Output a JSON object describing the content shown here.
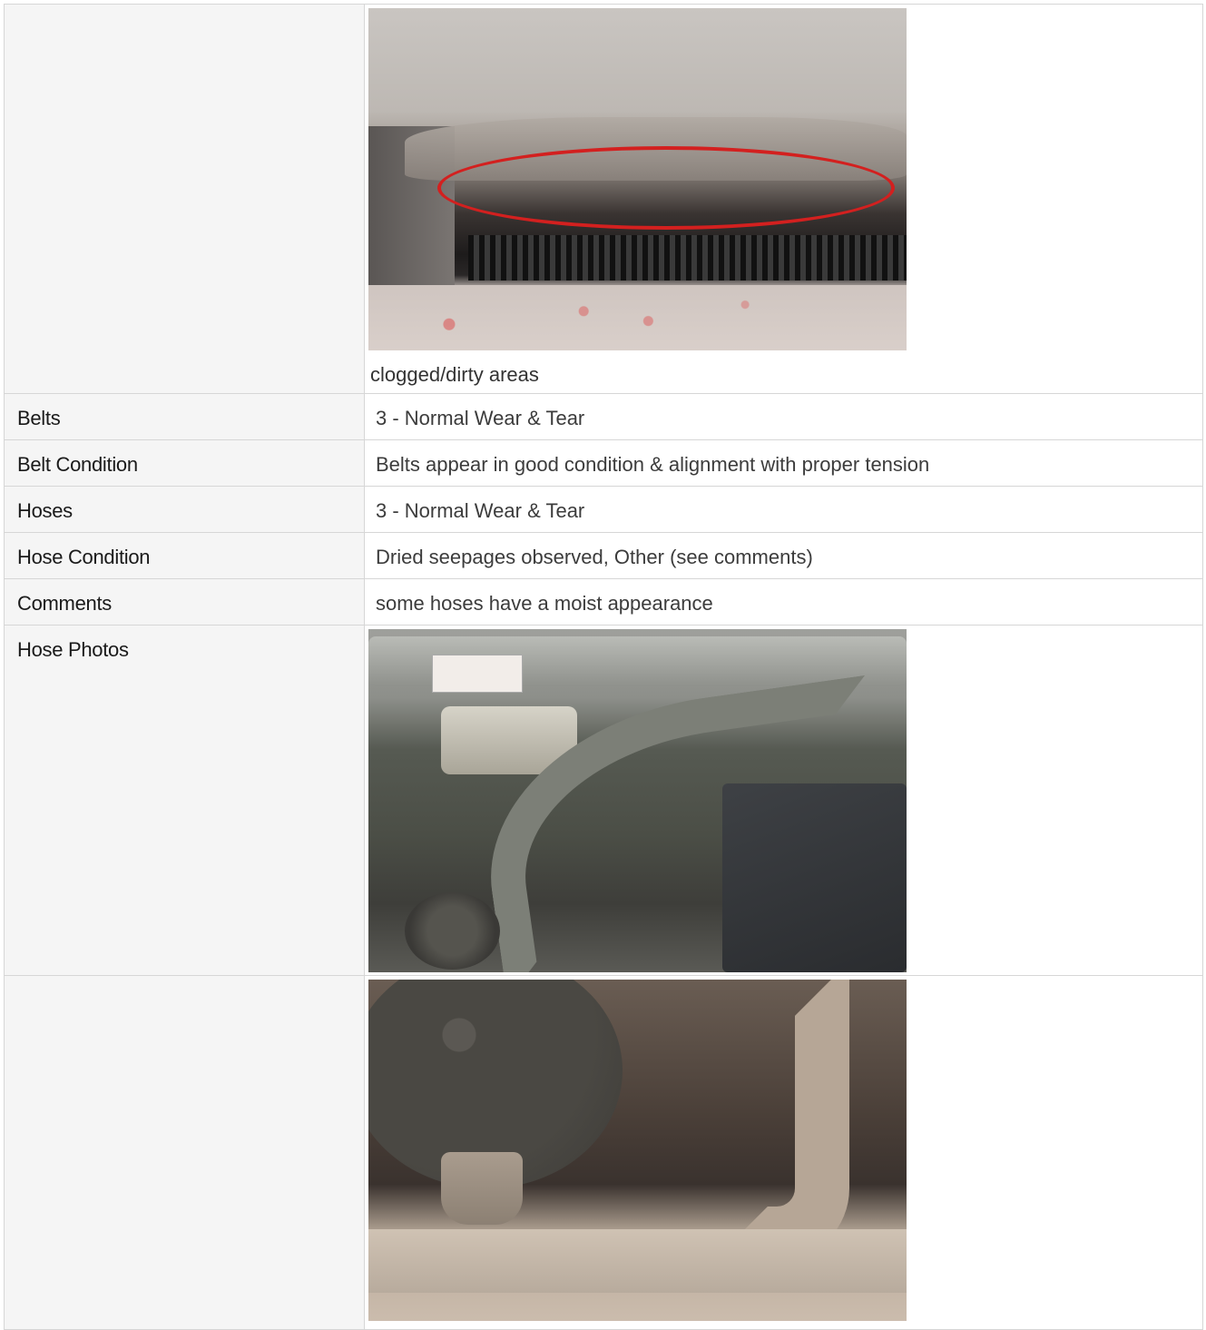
{
  "top_section": {
    "label": "",
    "photo_icon": "radiator-clog-photo",
    "caption": "clogged/dirty areas"
  },
  "rows": [
    {
      "label": "Belts",
      "value": "3 - Normal Wear & Tear"
    },
    {
      "label": "Belt Condition",
      "value": "Belts appear in good condition & alignment with proper tension"
    },
    {
      "label": "Hoses",
      "value": "3 - Normal Wear & Tear"
    },
    {
      "label": "Hose Condition",
      "value": "Dried seepages observed, Other (see comments)"
    },
    {
      "label": "Comments",
      "value": "some hoses have a moist appearance"
    }
  ],
  "hose_photos": {
    "label": "Hose Photos",
    "photo_icon": "engine-hose-photo"
  },
  "bottom_section": {
    "label": "",
    "photo_icon": "air-filter-hose-photo"
  },
  "colors": {
    "label_bg": "#f5f5f5",
    "border": "#d6d6d6",
    "annotation_ring": "#d3201f"
  }
}
